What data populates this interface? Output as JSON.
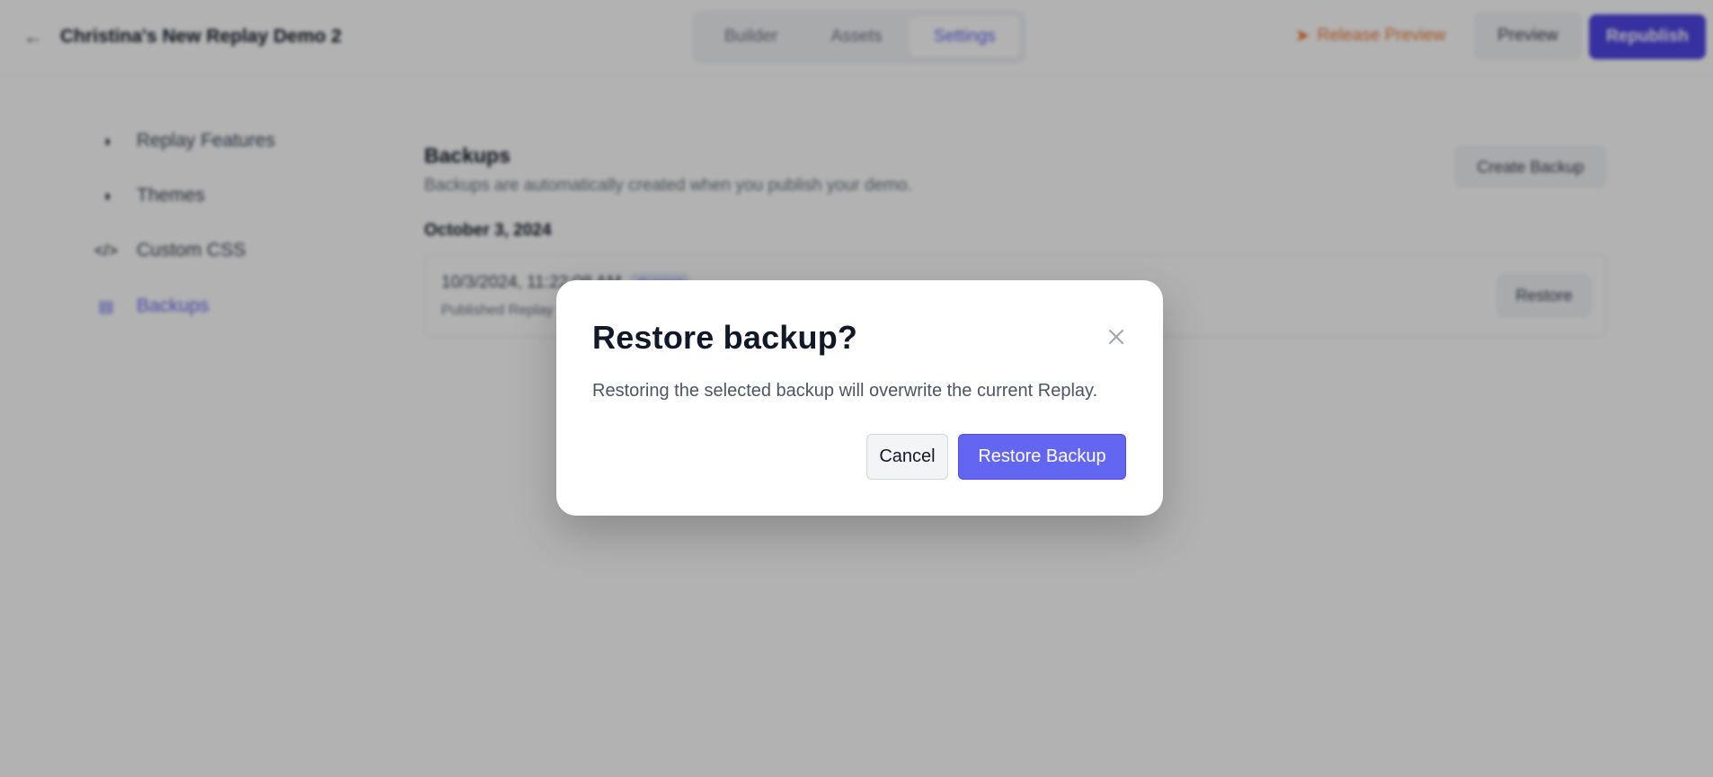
{
  "topbar": {
    "back_icon": "arrow-left-icon",
    "title": "Christina's New Replay Demo 2",
    "tabs": [
      {
        "label": "Builder"
      },
      {
        "label": "Assets"
      },
      {
        "label": "Settings",
        "active": true
      }
    ],
    "release_icon": "rocket-icon",
    "release_label": "Release Preview",
    "preview_label": "Preview",
    "republish_label": "Republish"
  },
  "sidebar": {
    "items": [
      {
        "label": "Replay Features",
        "icon": "toggle-icon"
      },
      {
        "label": "Themes",
        "icon": "toggle-icon"
      },
      {
        "label": "Custom CSS",
        "icon": "code-icon"
      },
      {
        "label": "Backups",
        "icon": "archive-icon",
        "active": true
      }
    ]
  },
  "backups": {
    "title": "Backups",
    "subtitle": "Backups are automatically created when you publish your demo.",
    "create_label": "Create Backup",
    "date_heading": "October 3, 2024",
    "entry": {
      "timestamp": "10/3/2024, 11:22:08 AM",
      "badge": "Current",
      "description": "Published Replay",
      "restore_label": "Restore"
    }
  },
  "modal": {
    "title": "Restore backup?",
    "body": "Restoring the selected backup will overwrite the current Replay.",
    "cancel_label": "Cancel",
    "confirm_label": "Restore Backup",
    "close_icon": "close-icon"
  },
  "colors": {
    "accent": "#6366f1",
    "republish": "#4f46e5",
    "release": "#ea7a34",
    "overlay": "rgba(0,0,0,0.30)"
  }
}
